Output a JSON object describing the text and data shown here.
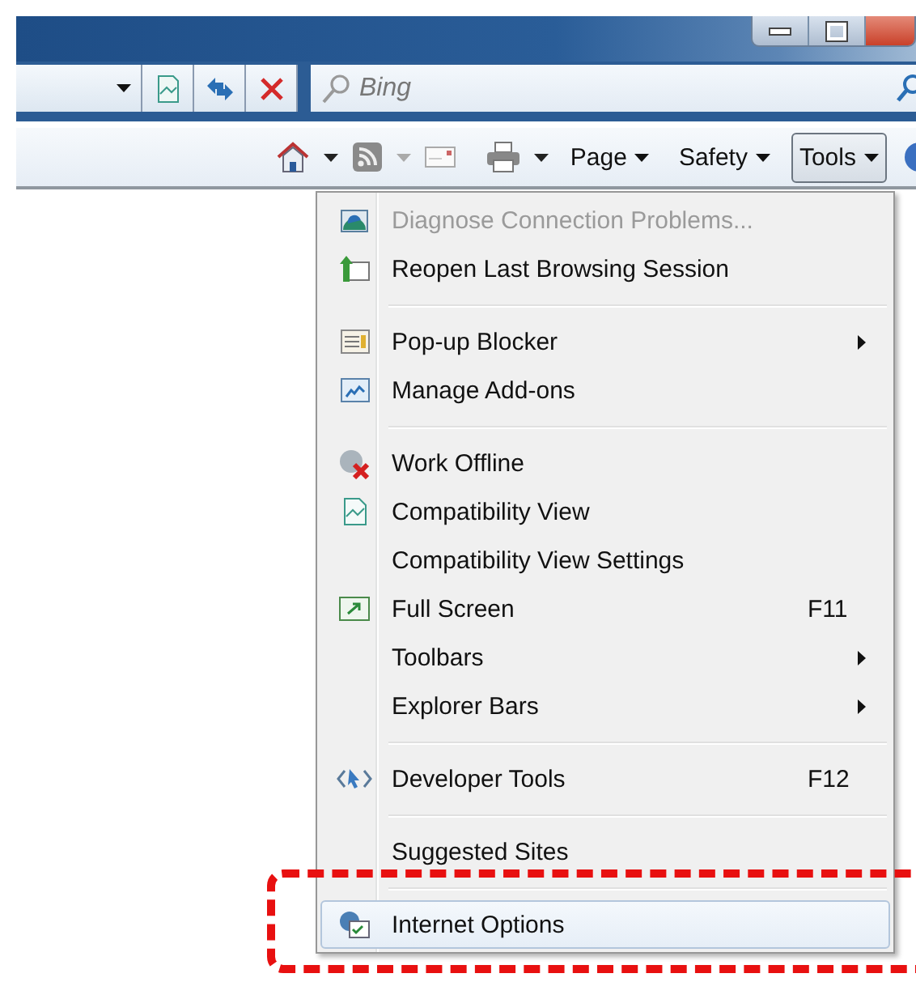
{
  "nav_bar": {
    "search": {
      "placeholder": "Bing"
    }
  },
  "command_bar": {
    "menus": [
      {
        "label": "Page",
        "selected": false
      },
      {
        "label": "Safety",
        "selected": false
      },
      {
        "label": "Tools",
        "selected": true
      }
    ]
  },
  "tools_menu": {
    "items": [
      {
        "kind": "item",
        "label": "Diagnose Connection Problems...",
        "disabled": true,
        "selected": false
      },
      {
        "kind": "item",
        "label": "Reopen Last Browsing Session",
        "disabled": false,
        "selected": false
      },
      {
        "kind": "separator"
      },
      {
        "kind": "item",
        "label": "Pop-up Blocker",
        "disabled": false,
        "selected": false,
        "submenu": true
      },
      {
        "kind": "item",
        "label": "Manage Add-ons",
        "disabled": false,
        "selected": false
      },
      {
        "kind": "separator"
      },
      {
        "kind": "item",
        "label": "Work Offline",
        "disabled": false,
        "selected": false
      },
      {
        "kind": "item",
        "label": "Compatibility View",
        "disabled": false,
        "selected": false
      },
      {
        "kind": "item",
        "label": "Compatibility View Settings",
        "disabled": false,
        "selected": false
      },
      {
        "kind": "item",
        "label": "Full Screen",
        "disabled": false,
        "selected": false,
        "shortcut": "F11"
      },
      {
        "kind": "item",
        "label": "Toolbars",
        "disabled": false,
        "selected": false,
        "submenu": true
      },
      {
        "kind": "item",
        "label": "Explorer Bars",
        "disabled": false,
        "selected": false,
        "submenu": true
      },
      {
        "kind": "separator"
      },
      {
        "kind": "item",
        "label": "Developer Tools",
        "disabled": false,
        "selected": false,
        "shortcut": "F12"
      },
      {
        "kind": "separator"
      },
      {
        "kind": "item",
        "label": "Suggested Sites",
        "disabled": false,
        "selected": false
      },
      {
        "kind": "separator"
      },
      {
        "kind": "item",
        "label": "Internet Options",
        "disabled": false,
        "selected": true
      }
    ]
  }
}
